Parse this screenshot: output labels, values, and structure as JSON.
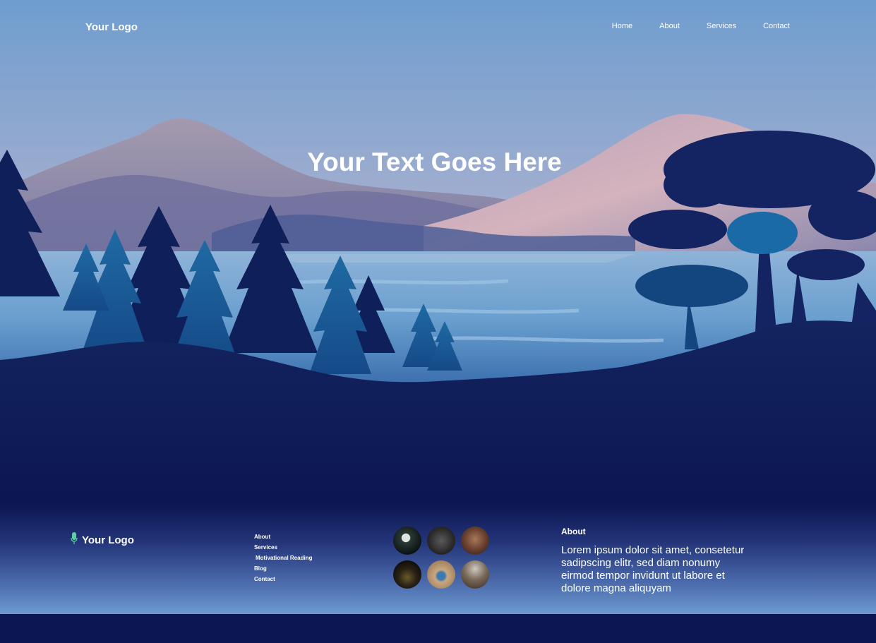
{
  "header": {
    "logo": "Your Logo",
    "nav": [
      "Home",
      "About",
      "Services",
      "Contact"
    ]
  },
  "hero": {
    "headline": "Your Text Goes Here"
  },
  "footer": {
    "logo": "Your Logo",
    "logo_icon": "microphone-icon",
    "links": [
      "About",
      "Services",
      "Motivational Reading",
      "Blog",
      "Contact"
    ],
    "gallery_count": 6,
    "about_title": "About",
    "about_text": "Lorem ipsum dolor sit amet, consetetur sadipscing elitr, sed diam nonumy eirmod tempor invidunt ut labore et dolore magna aliquyam"
  },
  "colors": {
    "sky_top": "#6f9dcf",
    "sky_bottom": "#d9b8c0",
    "deep_navy": "#0c1650",
    "mountain": "#7f7ea8",
    "lake": "#5a8fc4",
    "mic_accent": "#5fd0a2"
  }
}
